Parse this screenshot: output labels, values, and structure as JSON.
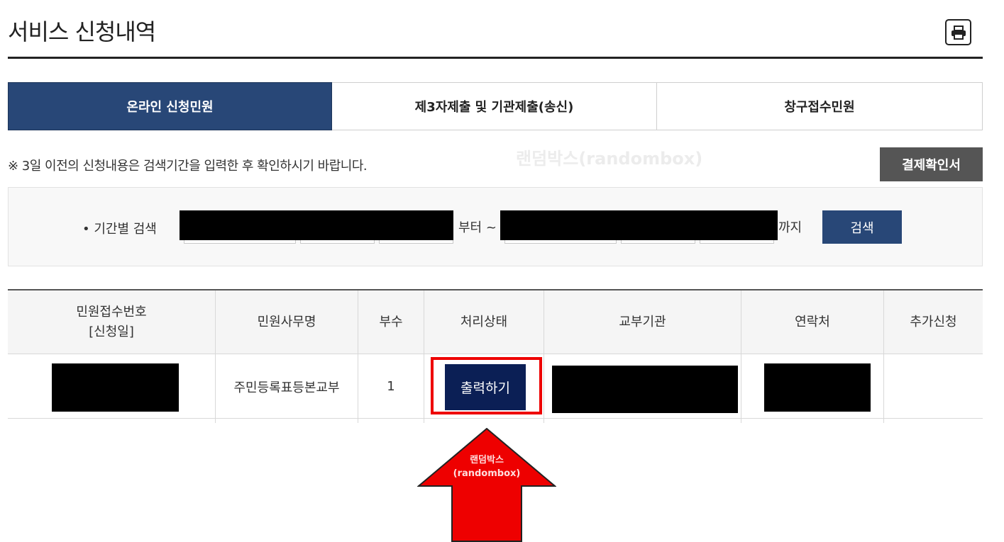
{
  "page": {
    "title": "서비스 신청내역"
  },
  "tabs": [
    {
      "label": "온라인 신청민원",
      "active": true
    },
    {
      "label": "제3자제출 및 기관제출(송신)",
      "active": false
    },
    {
      "label": "창구접수민원",
      "active": false
    }
  ],
  "notice": "※ 3일 이전의 신청내용은 검색기간을 입력한 후 확인하시기 바랍니다.",
  "watermark": "랜덤박스(randombox)",
  "receipt_button": "결제확인서",
  "search": {
    "label": "• 기간별 검색",
    "from_suffix": "부터 ~",
    "until_suffix": "까지",
    "button": "검색"
  },
  "table": {
    "headers": {
      "receipt_no_line1": "민원접수번호",
      "receipt_no_line2": "[신청일]",
      "service_name": "민원사무명",
      "copies": "부수",
      "status": "처리상태",
      "issuing_agency": "교부기관",
      "contact": "연락처",
      "additional": "추가신청"
    },
    "rows": [
      {
        "service_name": "주민등록표등본교부",
        "copies": "1",
        "status_button": "출력하기"
      }
    ]
  },
  "annotation": {
    "line1": "랜덤박스",
    "line2": "(randombox)"
  },
  "colors": {
    "primary": "#284777",
    "button_dark": "#0b1f55",
    "highlight": "#ee0000",
    "arrow": "#ee0000"
  }
}
